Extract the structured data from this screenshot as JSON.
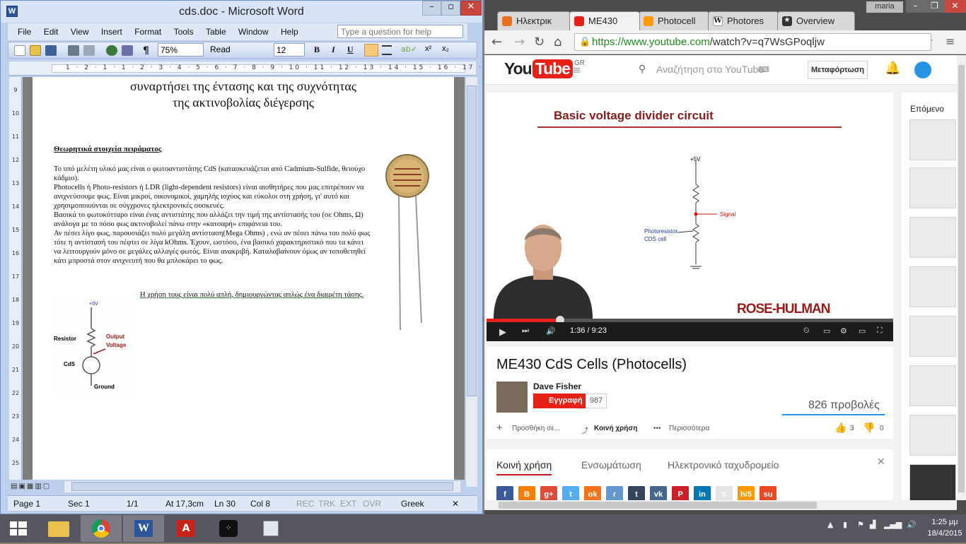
{
  "word": {
    "title": "cds.doc - Microsoft Word",
    "icon_name": "word-doc-icon",
    "menu": [
      "File",
      "Edit",
      "View",
      "Insert",
      "Format",
      "Tools",
      "Table",
      "Window",
      "Help"
    ],
    "help_placeholder": "Type a question for help",
    "zoom": "75%",
    "read_label": "Read",
    "font_size": "12",
    "bold": "B",
    "italic": "I",
    "underline": "U",
    "ruler_numbers": "1 · 2 · 1 · 1 · 2 · 3 · 4 · 5 · 6 · 7 · 8 · 9 · 10 · 11 · 12 · 13 · 14 · 15 · 16 · 17 · 18 · 19 · 20",
    "vruler_numbers": [
      "9",
      "10",
      "11",
      "12",
      "13",
      "14",
      "15",
      "16",
      "17",
      "18",
      "19",
      "20",
      "21",
      "22",
      "23",
      "24",
      "25"
    ],
    "doc": {
      "heading_line1": "συναρτήσει της έντασης και της συχνότητας",
      "heading_line2": "της ακτινοβολίας διέγερσης",
      "section_title": "Θεωρητικά στοιχεία πειράματος",
      "p1": "Το υπό μελέτη υλικό μας είναι ο φωτοαντιστάτης CdS (κατασκευάζεται από Cadmium-Sulfide, θειούχο κάδμιο).",
      "p2": "Photocells ή Photo-resistors ή LDR (light-dependent resistors) είναι αισθητήρες που μας επιτρέπουν να ανιχνεύσουμε φως. Είναι μικροί, οικονομικοί, χαμηλής ισχύος και εύκολοι στη χρήση, γι' αυτό και χρησιμοποιούνται σε σύγχρονες ηλεκτρονικές συσκευές.",
      "p3": "Βασικά το φωτοκύτταρο είναι ένας αντιστάτης που αλλάζει την τιμή της αντίστασής του (σε Ohms, Ω) ανάλογα με το πόσο φως ακτινοβολεί πάνω στην «κατσαρή» επιφάνεια του.",
      "p4": "Αν πέσει λίγο φως, παρουσιάζει πολύ μεγάλη αντίσταση(Mega Ohms) , ενώ αν πέσει πάνω του πολύ φως τότε η αντίστασή του πέφτει σε λίγα kOhms. Έχουν, ωστόσο, ένα βασικό χαρακτηριστικό που τα κάνει να λειτουργούν μόνο σε μεγάλες αλλαγές φωτός. Είναι ανακριβή. Καταλαβαίνουν όμως αν τοποθετηθεί κάτι μπροστά στον ανιχνευτή που θα μπλοκάρει το φως.",
      "caption": "Η χρήση τους είναι πολύ απλή, δημιουργώντας απλώς ένα διαιρέτη τάσης.",
      "diagram": {
        "vplus": "+5V",
        "resistor": "Resistor",
        "output1": "Output",
        "output2": "Voltage",
        "cds": "CdS",
        "ground": "Ground"
      }
    },
    "status": {
      "page": "Page  1",
      "sec": "Sec  1",
      "pages": "1/1",
      "at": "At  17,3cm",
      "ln": "Ln  30",
      "col": "Col  8",
      "rec": "REC",
      "trk": "TRK",
      "ext": "EXT",
      "ovr": "OVR",
      "lang": "Greek"
    }
  },
  "chrome": {
    "user": "maria",
    "tabs": [
      {
        "label": "Ηλεκτρικ",
        "icon": "#e8711c"
      },
      {
        "label": "ME430",
        "icon": "#e62117"
      },
      {
        "label": "Photocell",
        "icon": "#ff9900"
      },
      {
        "label": "Photores",
        "icon": "#ffffff"
      },
      {
        "label": "Overview",
        "icon": "#333333"
      }
    ],
    "url_host": "https://www.youtube.com",
    "url_rest": "/watch?v=q7WsGPoqljw",
    "youtube": {
      "logo_you": "You",
      "logo_tube": "Tube",
      "region": "GR",
      "search_placeholder": "Αναζήτηση στο YouTube",
      "upload": "Μεταφόρτωση",
      "slide_title": "Basic voltage divider circuit",
      "slide_labels": {
        "vplus": "+5V",
        "signal": "Signal",
        "photo1": "Photoresistor",
        "photo2": "CDS cell"
      },
      "brand": "ROSE-HULMAN",
      "time": "1:36 / 9:23",
      "progress": 0.18,
      "video_title": "ME430 CdS Cells (Photocells)",
      "channel": "Dave Fisher",
      "subscribe": "Εγγραφή",
      "sub_count": "987",
      "views": "826 προβολές",
      "add_to": "Προσθήκη σε...",
      "share": "Κοινή χρήση",
      "more": "Περισσότερα",
      "like_count": "3",
      "dislike_count": "0",
      "share_tabs": [
        "Κοινή χρήση",
        "Ενσωμάτωση",
        "Ηλεκτρονικό ταχυδρομείο"
      ],
      "up_next": "Επόμενο",
      "share_icons": [
        {
          "name": "facebook-icon",
          "label": "f",
          "color": "#3b5998"
        },
        {
          "name": "blogger-icon",
          "label": "B",
          "color": "#f57d00"
        },
        {
          "name": "googleplus-icon",
          "label": "g+",
          "color": "#dd4b39"
        },
        {
          "name": "twitter-icon",
          "label": "t",
          "color": "#55acee"
        },
        {
          "name": "odnoklassniki-icon",
          "label": "ok",
          "color": "#f4731c"
        },
        {
          "name": "reddit-icon",
          "label": "r",
          "color": "#5f99cf"
        },
        {
          "name": "tumblr-icon",
          "label": "t",
          "color": "#35465c"
        },
        {
          "name": "vk-icon",
          "label": "vk",
          "color": "#45668e"
        },
        {
          "name": "pinterest-icon",
          "label": "P",
          "color": "#cb2027"
        },
        {
          "name": "linkedin-icon",
          "label": "in",
          "color": "#0077b5"
        },
        {
          "name": "stumble-icon",
          "label": "S",
          "color": "#e4e4e4"
        },
        {
          "name": "hi5-icon",
          "label": "hi5",
          "color": "#ff9900"
        },
        {
          "name": "stumbleupon-icon",
          "label": "su",
          "color": "#eb4924"
        }
      ]
    }
  },
  "taskbar": {
    "apps": [
      "file-explorer-icon",
      "chrome-icon",
      "word-icon",
      "acrobat-icon",
      "blackberry-icon",
      "snipping-icon"
    ],
    "time": "1:25 μμ",
    "date": "18/4/2015"
  }
}
